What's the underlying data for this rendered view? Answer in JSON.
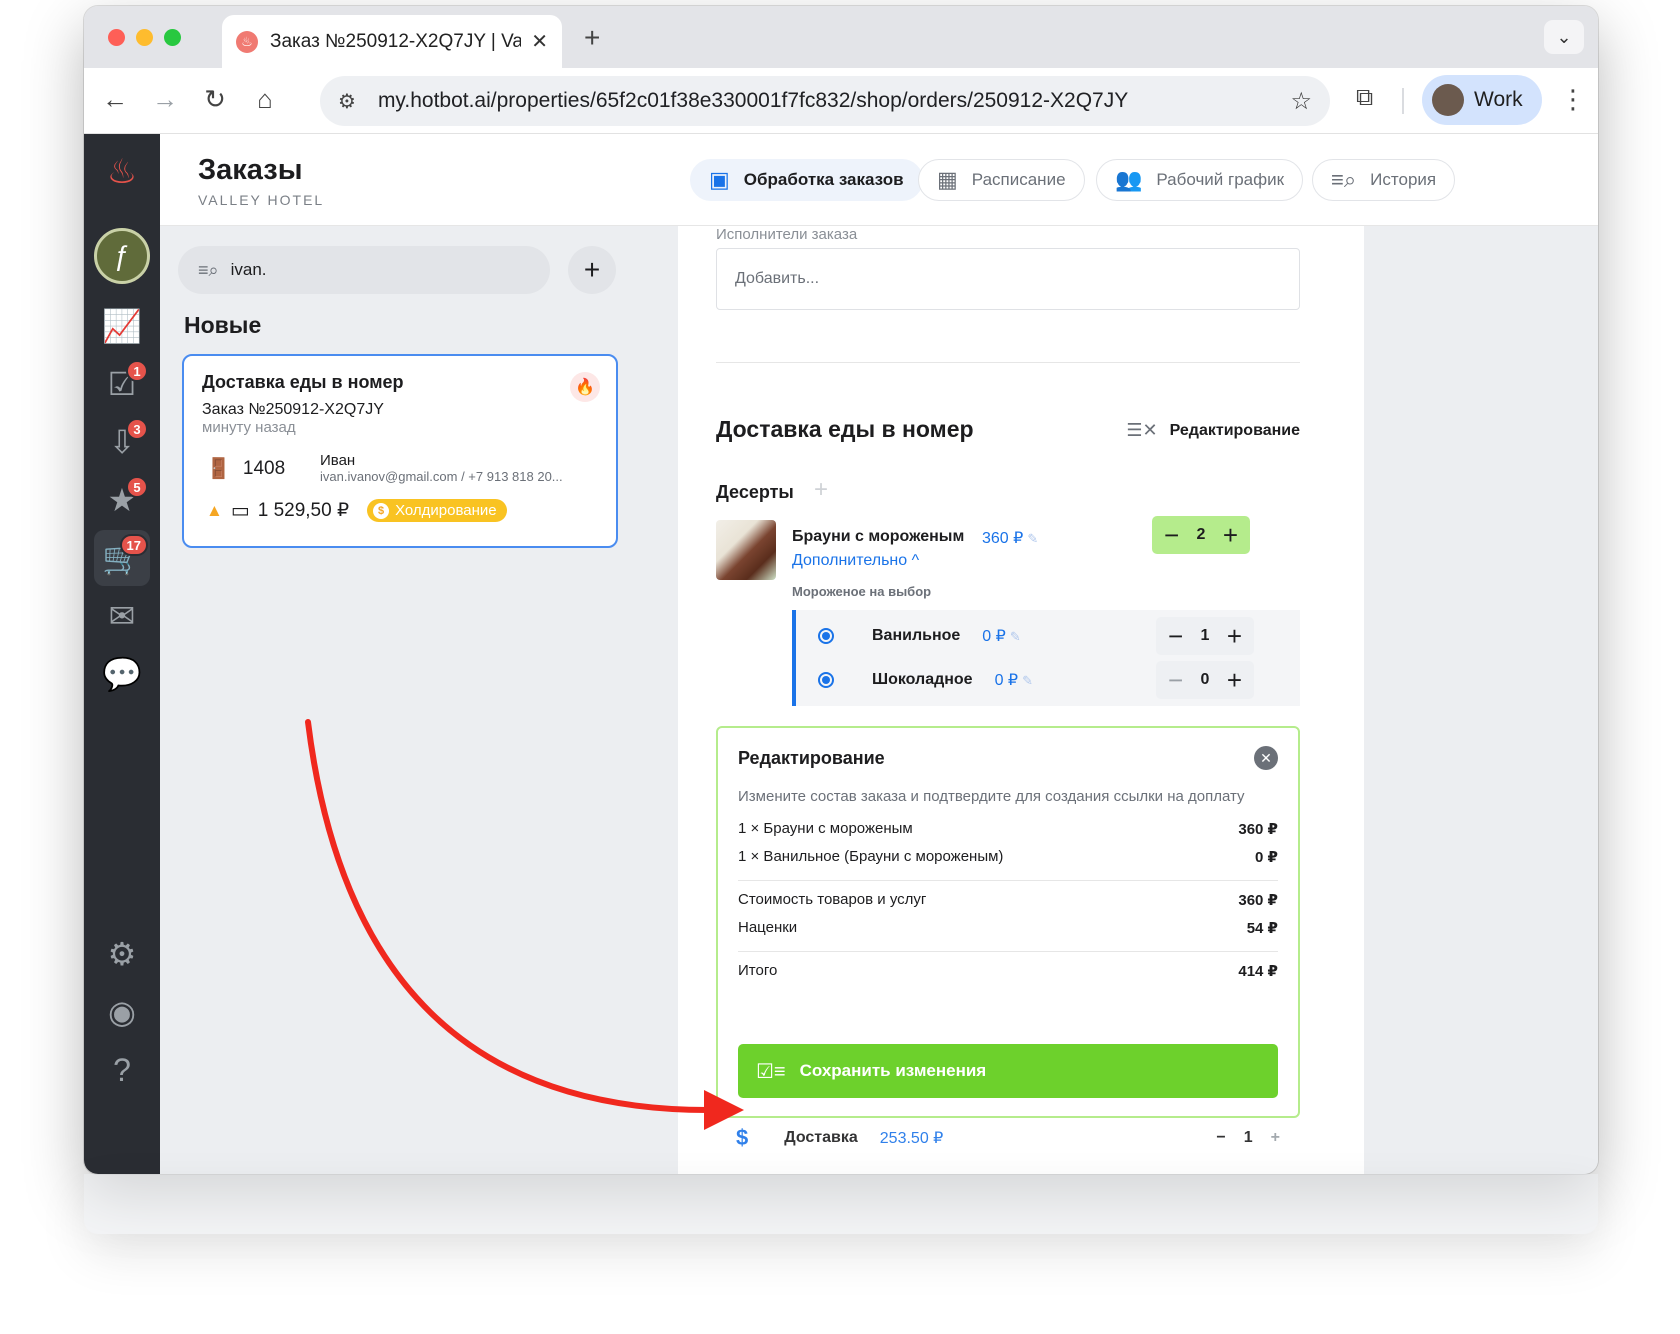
{
  "browser": {
    "tab_title": "Заказ №250912-X2Q7JY | Va",
    "tab_favicon": "hotbot-flame-icon",
    "url": "my.hotbot.ai/properties/65f2c01f38e330001f7fc832/shop/orders/250912-X2Q7JY",
    "profile_label": "Work"
  },
  "sidebar": {
    "badges": {
      "tasks": "1",
      "inbox": "3",
      "reviews": "5",
      "shop": "17"
    }
  },
  "header": {
    "title": "Заказы",
    "subtitle": "VALLEY HOTEL",
    "tabs": [
      {
        "label": "Обработка заказов",
        "icon": "inbox-icon",
        "active": true
      },
      {
        "label": "Расписание",
        "icon": "calendar-icon",
        "active": false
      },
      {
        "label": "Рабочий график",
        "icon": "staff-icon",
        "active": false
      },
      {
        "label": "История",
        "icon": "history-search-icon",
        "active": false
      }
    ]
  },
  "left": {
    "search_value": "ivan.",
    "section_title": "Новые",
    "order": {
      "title": "Доставка еды в номер",
      "number": "Заказ №250912-X2Q7JY",
      "time": "минуту назад",
      "room": "1408",
      "guest_name": "Иван",
      "guest_contact": "ivan.ivanov@gmail.com / +7 913 818 20...",
      "amount": "1 529,50 ₽",
      "status": "Холдирование"
    }
  },
  "detail": {
    "executors_label": "Исполнители заказа",
    "executors_placeholder": "Добавить...",
    "service_title": "Доставка еды в номер",
    "edit_label": "Редактирование",
    "category": "Десерты",
    "product": {
      "name": "Брауни с мороженым",
      "price": "360 ₽",
      "more": "Дополнительно ^",
      "qty": "2"
    },
    "options_label": "Мороженое на выбор",
    "options": [
      {
        "name": "Ванильное",
        "price": "0 ₽",
        "qty": "1"
      },
      {
        "name": "Шоколадное",
        "price": "0 ₽",
        "qty": "0"
      }
    ],
    "delivery": {
      "name": "Доставка",
      "price": "253.50 ₽",
      "qty": "1"
    }
  },
  "modal": {
    "title": "Редактирование",
    "description": "Измените состав заказа и подтвердите для создания ссылки на доплату",
    "items": [
      {
        "label": "1 × Брауни с мороженым",
        "value": "360 ₽"
      },
      {
        "label": "1 × Ванильное (Брауни с мороженым)",
        "value": "0 ₽"
      }
    ],
    "subtotal_label": "Стоимость товаров и услуг",
    "subtotal_value": "360 ₽",
    "markup_label": "Наценки",
    "markup_value": "54 ₽",
    "total_label": "Итого",
    "total_value": "414 ₽",
    "save_label": "Сохранить изменения"
  },
  "colors": {
    "accent_blue": "#1a73e8",
    "save_green": "#6dd12c",
    "stepper_green": "#b5ec8c",
    "sidebar_dark": "#2a2d33",
    "badge_red": "#e5534b",
    "hold_yellow": "#f9c322",
    "annotation_arrow": "#f0281e"
  }
}
